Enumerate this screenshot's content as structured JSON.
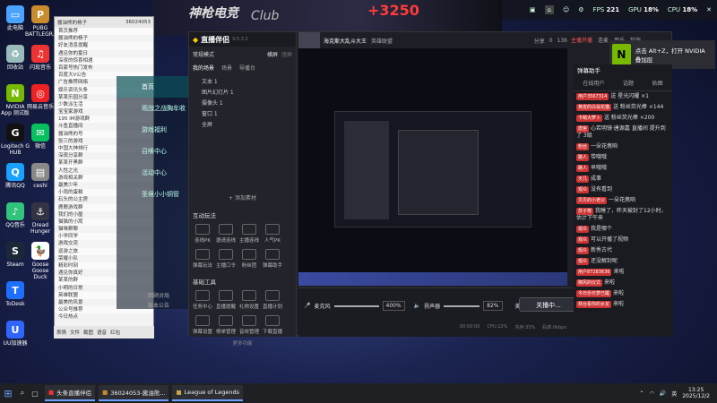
{
  "desktop_icons": [
    {
      "label": "此电脑",
      "color": "#4aa3ff",
      "glyph": "▭"
    },
    {
      "label": "回收站",
      "color": "#9bb",
      "glyph": "♻"
    },
    {
      "label": "NVIDIA App 测试版",
      "color": "#76b900",
      "glyph": "N"
    },
    {
      "label": "Logitech G HUB",
      "color": "#111",
      "glyph": "G"
    },
    {
      "label": "腾讯QQ",
      "color": "#1aa1ff",
      "glyph": "Q"
    },
    {
      "label": "QQ音乐",
      "color": "#31c27c",
      "glyph": "♪"
    },
    {
      "label": "Steam",
      "color": "#1b2838",
      "glyph": "S"
    },
    {
      "label": "ToDesk",
      "color": "#1f6fff",
      "glyph": "T"
    },
    {
      "label": "UU加速器",
      "color": "#3064ff",
      "glyph": "U"
    }
  ],
  "desktop_icons_col2": [
    {
      "label": "PUBG BATTLEGR...",
      "color": "#c98b2c",
      "glyph": "P"
    },
    {
      "label": "闪现音乐",
      "color": "#e33",
      "glyph": "♫"
    },
    {
      "label": "网易云音乐",
      "color": "#e22",
      "glyph": "◎"
    },
    {
      "label": "微信",
      "color": "#07c160",
      "glyph": "✉"
    },
    {
      "label": "ceshi",
      "color": "#888",
      "glyph": "▤"
    },
    {
      "label": "Dread Hunger",
      "color": "#334",
      "glyph": "⚓"
    },
    {
      "label": "Goose Goose Duck",
      "color": "#fff",
      "glyph": "🦆"
    }
  ],
  "top_stats": {
    "fps_label": "FPS",
    "fps": "221",
    "gpu_label": "GPU",
    "gpu": "18%",
    "cpu_label": "CPU",
    "cpu": "18%"
  },
  "overlay": {
    "brand": "神枪电竞",
    "club": "Club",
    "score": "+3250"
  },
  "chat_window": {
    "title": "酱油熊的杨子",
    "group_id": "36024053",
    "search_placeholder": "搜索",
    "rows": [
      "首页推荐",
      "酱油熊的杨子",
      "好友消息提醒",
      "遇见你的夏日",
      "深夜的惊喜相遇",
      "百家号热门发布",
      "百度大V公告",
      "广告推荐网络",
      "娱乐资讯头条",
      "某某乐园分享",
      "少数派生活",
      "宝宝家游戏",
      "195 IM游戏群",
      "斗鱼直播间",
      "酱油熊的号",
      "张三的游戏",
      "中国大神排行",
      "深夜分享群",
      "某某开黑群",
      "人性之光",
      "游戏相关群",
      "最美少年",
      "小雨的蛋糕",
      "石头的公主房",
      "鹿鹿游戏群",
      "我们的小屋",
      "猫猫的小窝",
      "猫咪群聊",
      "小学同学",
      "游戏交流",
      "巡游之旅",
      "荣耀小队",
      "精彩时刻",
      "遇见你真好",
      "某某的群",
      "小明的日常",
      "英雄联盟",
      "最美的风景",
      "公众号推荐",
      "今日热点"
    ],
    "bottom_tools": [
      "表情",
      "文件",
      "截图",
      "语音",
      "红包"
    ]
  },
  "game_nav": {
    "items": [
      "首页",
      "观战之战胸牟收",
      "游戏福利",
      "召唤中心",
      "活动中心",
      "圣境小小铜管"
    ],
    "footer": [
      "回顾对局",
      "版本公告"
    ]
  },
  "app": {
    "title": "直播伴侣",
    "version": "9.5.3.2",
    "scene_mode": "常规模式",
    "header_right": [
      "横屏",
      "竖屏"
    ],
    "source_tabs": [
      "我的场景",
      "场景",
      "导播台"
    ],
    "sources": [
      "文本 1",
      "图片幻灯片 1",
      "摄像头 1",
      "窗口 1",
      "全屏"
    ],
    "add_material": "+ 添加素材",
    "interact_title": "互动玩法",
    "interact_tools": [
      "连线PK",
      "邀请连线",
      "主播连线",
      "人气PK",
      "弹幕玩法",
      "主播口令",
      "粉丝团",
      "弹幕助手"
    ],
    "basic_title": "基础工具",
    "basic_tools": [
      "任务中心",
      "直播提醒",
      "礼物设置",
      "直播计划",
      "弹幕设置",
      "榜单管理",
      "音效管理",
      "下载直播"
    ],
    "more": "更多功能",
    "stream": {
      "title": "海克斯大乱斗大王",
      "streamer_tag": "英雄联盟",
      "counters": [
        "分享",
        "0",
        "136"
      ],
      "rec": "直播中",
      "time": "00:00:00"
    },
    "controls": {
      "mic_label": "麦克风",
      "mic_value": "400%",
      "speaker_label": "扬声器",
      "speaker_value": "82%",
      "buttons": [
        "美颜",
        "录制",
        "设置"
      ],
      "go_live": "关播中...",
      "status": [
        "00:00:00",
        "CPU:22%",
        "内存:33%",
        "码率:0kbps",
        "帧率:0"
      ]
    },
    "right_header": [
      "主播开播",
      "连麦",
      "音乐",
      "装饰"
    ]
  },
  "toast": {
    "title": "点击 Alt+Z，打开 NVIDIA 叠加层"
  },
  "right_col": {
    "tabs": [
      "在线用户",
      "话题",
      "贴图"
    ],
    "header": "弹幕助手",
    "messages": [
      {
        "user": "用户3567314",
        "text": "送 星光闪耀 ×1"
      },
      {
        "user": "黄皮的白翁花猫",
        "text": "送 粉丝荧光棒 ×144"
      },
      {
        "user": "卡萌大萝卜",
        "text": "送 粉丝荧光棒 ×200"
      },
      {
        "user": "唐宫",
        "text": "心若明镜·唐源嘉 直播间 提升到了 3级"
      },
      {
        "user": "粉丝",
        "text": "一朵花携响"
      },
      {
        "user": "路人",
        "text": "带哦哦"
      },
      {
        "user": "路人",
        "text": "早哦哦"
      },
      {
        "user": "天几",
        "text": "成事"
      },
      {
        "user": "观众",
        "text": "没有看到"
      },
      {
        "user": "贝贝的小老公",
        "text": "一朵花携响"
      },
      {
        "user": "苏子桉",
        "text": "我睡了，昨天被封了12小时，估计下午来"
      },
      {
        "user": "观众",
        "text": "我是哪个"
      },
      {
        "user": "观众",
        "text": "可以开播了视频"
      },
      {
        "user": "观众",
        "text": "新秀古代"
      },
      {
        "user": "观众",
        "text": "还没解封呢"
      },
      {
        "user": "用户87283636",
        "text": "来啦"
      },
      {
        "user": "御风的仪式",
        "text": "来啦"
      },
      {
        "user": "今日份日梦已醒",
        "text": "来啦"
      },
      {
        "user": "林台看你的女友",
        "text": "来啦"
      }
    ]
  },
  "taskbar": {
    "items": [
      "头条直播伴侣",
      "36024053-酱油熊...",
      "League of Legends"
    ],
    "tray_lang": "英",
    "time": "13:25",
    "date": "2025/12/2"
  },
  "colors": {
    "accent": "#6aa0ff",
    "nvidia": "#76b900",
    "danger": "#e33"
  }
}
